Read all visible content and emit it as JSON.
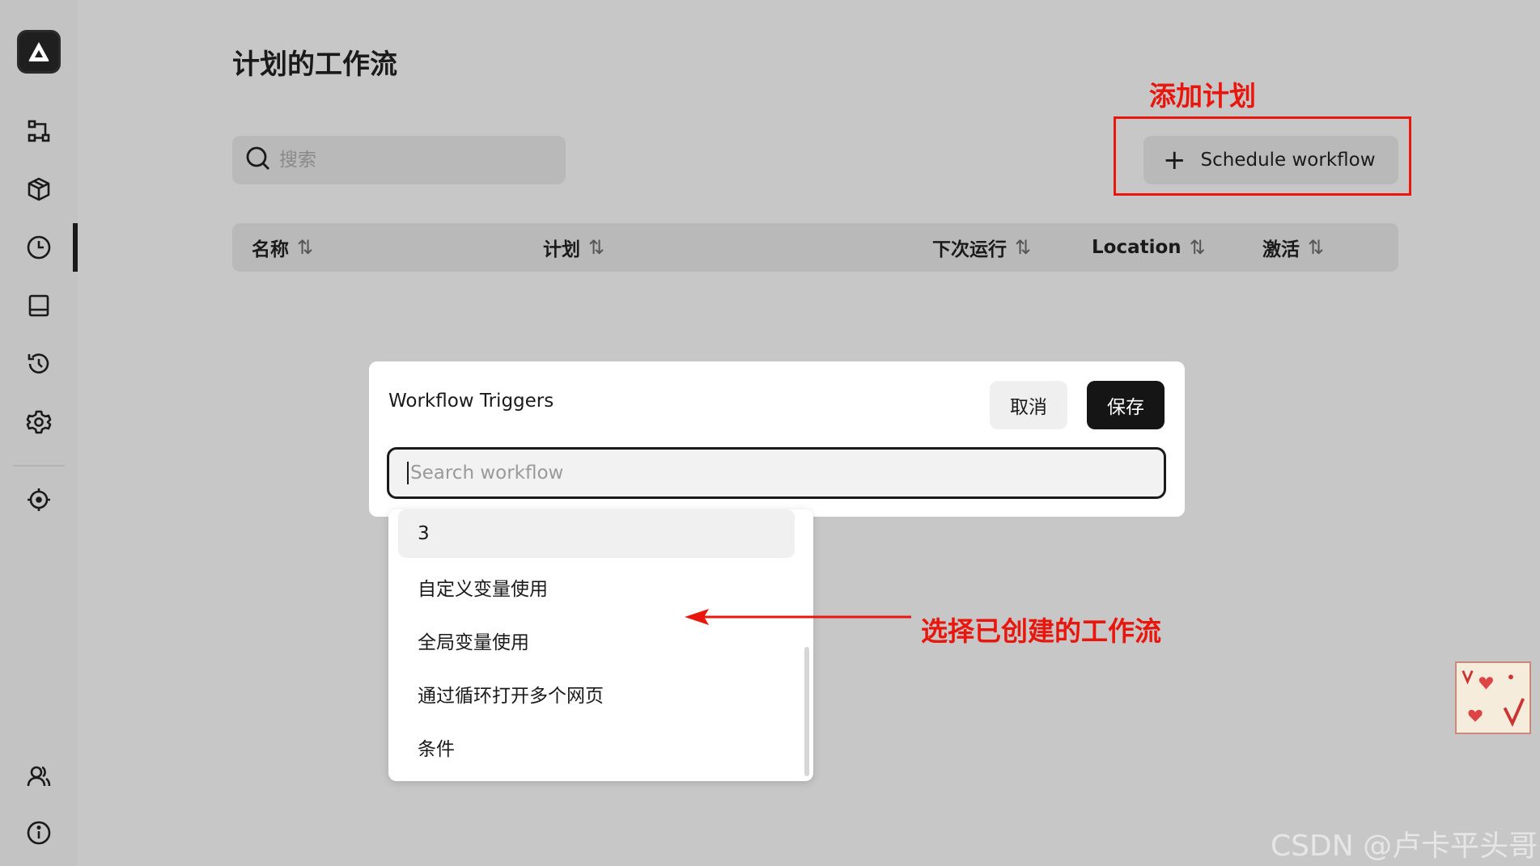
{
  "sidebar": {
    "logo_icon": "app-logo-icon",
    "items": [
      {
        "name": "workflows",
        "icon": "workflow-icon"
      },
      {
        "name": "packages",
        "icon": "package-icon"
      },
      {
        "name": "schedules",
        "icon": "clock-icon",
        "active": true
      },
      {
        "name": "storage",
        "icon": "storage-icon"
      },
      {
        "name": "history",
        "icon": "history-icon"
      },
      {
        "name": "settings",
        "icon": "gear-icon"
      },
      {
        "name": "element-picker",
        "icon": "crosshair-icon"
      },
      {
        "name": "team",
        "icon": "users-icon"
      },
      {
        "name": "about",
        "icon": "info-icon"
      }
    ]
  },
  "page": {
    "title": "计划的工作流",
    "search_placeholder": "搜索",
    "schedule_button_label": "Schedule workflow"
  },
  "table": {
    "columns": [
      "名称",
      "计划",
      "下次运行",
      "Location",
      "激活"
    ],
    "sort_glyph": "⇅"
  },
  "modal": {
    "title": "Workflow Triggers",
    "cancel_label": "取消",
    "save_label": "保存",
    "search_placeholder": "Search workflow"
  },
  "dropdown": {
    "items": [
      "3",
      "自定义变量使用",
      "全局变量使用",
      "通过循环打开多个网页",
      "条件"
    ]
  },
  "annotations": {
    "add_plan": "添加计划",
    "select_workflow": "选择已创建的工作流",
    "color": "#e8160c"
  },
  "watermark": "CSDN @卢卡平头哥"
}
